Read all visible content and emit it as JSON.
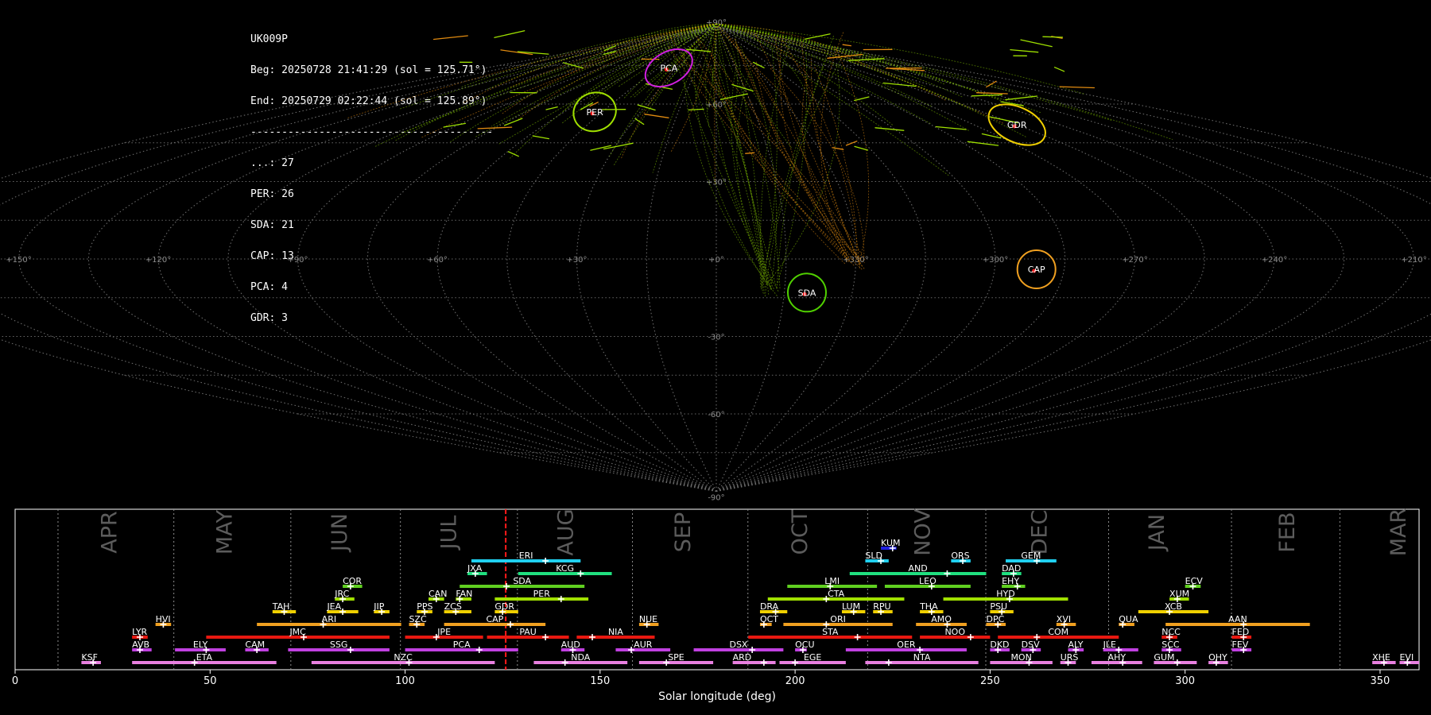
{
  "stats": {
    "lines": [
      "UK009P",
      "Beg: 20250728 21:41:29 (sol = 125.71°)",
      "End: 20250729 02:22:44 (sol = 125.89°)",
      "---------------------------------------",
      "...: 27",
      "PER: 26",
      "SDA: 21",
      "CAP: 13",
      "PCA: 4",
      "GDR: 3"
    ]
  },
  "colors": {
    "background": "#000000",
    "grid": "#8c8c8c",
    "sporadic": "#a0d000",
    "orange": "#e08a10",
    "cursor": "#ff1a1a"
  },
  "chart_data": [
    {
      "type": "scatter",
      "projection": "sinusoidal",
      "ra_ticks": [
        "+180°",
        "+150°",
        "+120°",
        "+90°",
        "+60°",
        "+30°",
        "+0°",
        "+330°",
        "+300°",
        "+270°",
        "+240°",
        "+210°",
        "+180°"
      ],
      "dec_ticks": [
        "+90°",
        "+60°",
        "+30°",
        "-30°",
        "-60°",
        "-90°"
      ],
      "radiants": [
        {
          "code": "PCA",
          "ra": -37,
          "dec": 74,
          "color": "#d020e0"
        },
        {
          "code": "PER",
          "ra": -48,
          "dec": 57,
          "color": "#a0e000"
        },
        {
          "code": "GDR",
          "ra": 105,
          "dec": 52,
          "color": "#f0d000"
        },
        {
          "code": "CAP",
          "ra": 69,
          "dec": -4,
          "color": "#f0a020"
        },
        {
          "code": "SDA",
          "ra": 20,
          "dec": -13,
          "color": "#50d000"
        }
      ],
      "meteor_counts": [
        {
          "label": "...",
          "count": 27
        },
        {
          "label": "PER",
          "count": 26
        },
        {
          "label": "SDA",
          "count": 21
        },
        {
          "label": "CAP",
          "count": 13
        },
        {
          "label": "PCA",
          "count": 4
        },
        {
          "label": "GDR",
          "count": 3
        }
      ]
    },
    {
      "type": "bar",
      "title": "",
      "xlabel": "Solar longitude (deg)",
      "xlim": [
        0,
        360
      ],
      "xticks": [
        0,
        50,
        100,
        150,
        200,
        250,
        300,
        350
      ],
      "current_sol": 125.8,
      "months": [
        {
          "name": "APR",
          "center": 24.5,
          "boundary_end": 40.7
        },
        {
          "name": "MAY",
          "center": 54,
          "boundary_end": 70.7
        },
        {
          "name": "JUN",
          "center": 83.5,
          "boundary_end": 98.8
        },
        {
          "name": "JUL",
          "center": 111.5,
          "boundary_end": 128.8
        },
        {
          "name": "AUG",
          "center": 141.5,
          "boundary_end": 158.3
        },
        {
          "name": "SEP",
          "center": 171.5,
          "boundary_end": 187.9
        },
        {
          "name": "OCT",
          "center": 201.5,
          "boundary_end": 218.6
        },
        {
          "name": "NOV",
          "center": 233,
          "boundary_end": 248.9
        },
        {
          "name": "DEC",
          "center": 263,
          "boundary_end": 280.4
        },
        {
          "name": "JAN",
          "center": 293,
          "boundary_end": 311.9
        },
        {
          "name": "FEB",
          "center": 326.5,
          "boundary_end": 339.7
        },
        {
          "name": "MAR",
          "center": 355,
          "boundary_end": null
        }
      ],
      "first_boundary": 11,
      "showers": [
        {
          "code": "KSF",
          "row": 0,
          "start": 17,
          "end": 22,
          "peak": 20,
          "color": "#e880e0"
        },
        {
          "code": "ETA",
          "row": 0,
          "start": 30,
          "end": 67,
          "peak": 46,
          "color": "#e880e0"
        },
        {
          "code": "NZC",
          "row": 0,
          "start": 76,
          "end": 123,
          "peak": 101,
          "color": "#e880e0"
        },
        {
          "code": "NDA",
          "row": 0,
          "start": 133,
          "end": 157,
          "peak": 141,
          "color": "#e880e0"
        },
        {
          "code": "SPE",
          "row": 0,
          "start": 160,
          "end": 179,
          "peak": 167,
          "color": "#e880e0"
        },
        {
          "code": "ARD",
          "row": 0,
          "start": 184,
          "end": 195,
          "peak": 192,
          "color": "#e880e0"
        },
        {
          "code": "EGE",
          "row": 0,
          "start": 196,
          "end": 213,
          "peak": 200,
          "color": "#e880e0"
        },
        {
          "code": "NTA",
          "row": 0,
          "start": 218,
          "end": 247,
          "peak": 224,
          "color": "#e880e0"
        },
        {
          "code": "MON",
          "row": 0,
          "start": 250,
          "end": 266,
          "peak": 260,
          "color": "#e880e0"
        },
        {
          "code": "URS",
          "row": 0,
          "start": 268,
          "end": 272,
          "peak": 270,
          "color": "#e880e0"
        },
        {
          "code": "AHY",
          "row": 0,
          "start": 276,
          "end": 289,
          "peak": 284,
          "color": "#e880e0"
        },
        {
          "code": "GUM",
          "row": 0,
          "start": 292,
          "end": 303,
          "peak": 298,
          "color": "#e880e0"
        },
        {
          "code": "OHY",
          "row": 0,
          "start": 306,
          "end": 311,
          "peak": 308,
          "color": "#e880e0"
        },
        {
          "code": "XHE",
          "row": 0,
          "start": 348,
          "end": 354,
          "peak": 351,
          "color": "#e880e0"
        },
        {
          "code": "EVI",
          "row": 0,
          "start": 355,
          "end": 360,
          "peak": 357,
          "color": "#e880e0"
        },
        {
          "code": "AVB",
          "row": 1,
          "start": 30,
          "end": 35,
          "peak": 32,
          "color": "#c040e0"
        },
        {
          "code": "ELY",
          "row": 1,
          "start": 41,
          "end": 54,
          "peak": 49,
          "color": "#c040e0"
        },
        {
          "code": "CAM",
          "row": 1,
          "start": 59,
          "end": 65,
          "peak": 62,
          "color": "#c040e0"
        },
        {
          "code": "SSG",
          "row": 1,
          "start": 70,
          "end": 96,
          "peak": 86,
          "color": "#c040e0"
        },
        {
          "code": "PCA",
          "row": 1,
          "start": 100,
          "end": 129,
          "peak": 119,
          "color": "#c040e0"
        },
        {
          "code": "AUD",
          "row": 1,
          "start": 140,
          "end": 146,
          "peak": 143,
          "color": "#c040e0"
        },
        {
          "code": "AUR",
          "row": 1,
          "start": 154,
          "end": 168,
          "peak": 158,
          "color": "#c040e0"
        },
        {
          "code": "DSX",
          "row": 1,
          "start": 174,
          "end": 197,
          "peak": 189,
          "color": "#c040e0"
        },
        {
          "code": "OCU",
          "row": 1,
          "start": 200,
          "end": 203,
          "peak": 202,
          "color": "#c040e0"
        },
        {
          "code": "OER",
          "row": 1,
          "start": 213,
          "end": 244,
          "peak": 232,
          "color": "#c040e0"
        },
        {
          "code": "DKD",
          "row": 1,
          "start": 250,
          "end": 255,
          "peak": 252,
          "color": "#c040e0"
        },
        {
          "code": "DSV",
          "row": 1,
          "start": 258,
          "end": 263,
          "peak": 261,
          "color": "#c040e0"
        },
        {
          "code": "ALY",
          "row": 1,
          "start": 270,
          "end": 274,
          "peak": 272,
          "color": "#c040e0"
        },
        {
          "code": "JLE",
          "row": 1,
          "start": 279,
          "end": 288,
          "peak": 283,
          "color": "#c040e0"
        },
        {
          "code": "SCC",
          "row": 1,
          "start": 294,
          "end": 299,
          "peak": 296,
          "color": "#c040e0"
        },
        {
          "code": "FEV",
          "row": 1,
          "start": 312,
          "end": 317,
          "peak": 315,
          "color": "#c040e0"
        },
        {
          "code": "LYR",
          "row": 2,
          "start": 30,
          "end": 34,
          "peak": 32,
          "color": "#e81810"
        },
        {
          "code": "JMC",
          "row": 2,
          "start": 49,
          "end": 96,
          "peak": 74,
          "color": "#e81810"
        },
        {
          "code": "JPE",
          "row": 2,
          "start": 100,
          "end": 120,
          "peak": 108,
          "color": "#e81810"
        },
        {
          "code": "PAU",
          "row": 2,
          "start": 121,
          "end": 142,
          "peak": 136,
          "color": "#e81810"
        },
        {
          "code": "NIA",
          "row": 2,
          "start": 144,
          "end": 164,
          "peak": 148,
          "color": "#e81810"
        },
        {
          "code": "STA",
          "row": 2,
          "start": 188,
          "end": 230,
          "peak": 216,
          "color": "#e81810"
        },
        {
          "code": "NOO",
          "row": 2,
          "start": 232,
          "end": 250,
          "peak": 245,
          "color": "#e81810"
        },
        {
          "code": "COM",
          "row": 2,
          "start": 252,
          "end": 283,
          "peak": 262,
          "color": "#e81810"
        },
        {
          "code": "NCC",
          "row": 2,
          "start": 294,
          "end": 298,
          "peak": 296,
          "color": "#e81810"
        },
        {
          "code": "FED",
          "row": 2,
          "start": 312,
          "end": 317,
          "peak": 315,
          "color": "#e81810"
        },
        {
          "code": "HVI",
          "row": 3,
          "start": 36,
          "end": 40,
          "peak": 38,
          "color": "#f0a020"
        },
        {
          "code": "ARI",
          "row": 3,
          "start": 62,
          "end": 99,
          "peak": 79,
          "color": "#f0a020"
        },
        {
          "code": "SZC",
          "row": 3,
          "start": 101,
          "end": 105,
          "peak": 103,
          "color": "#f0a020"
        },
        {
          "code": "CAP",
          "row": 3,
          "start": 110,
          "end": 136,
          "peak": 127,
          "color": "#f0a020"
        },
        {
          "code": "NUE",
          "row": 3,
          "start": 160,
          "end": 165,
          "peak": 162,
          "color": "#f0a020"
        },
        {
          "code": "OCT",
          "row": 3,
          "start": 191,
          "end": 194,
          "peak": 192,
          "color": "#f0a020"
        },
        {
          "code": "ORI",
          "row": 3,
          "start": 197,
          "end": 225,
          "peak": 208,
          "color": "#f0a020"
        },
        {
          "code": "AMO",
          "row": 3,
          "start": 231,
          "end": 244,
          "peak": 239,
          "color": "#f0a020"
        },
        {
          "code": "DPC",
          "row": 3,
          "start": 249,
          "end": 254,
          "peak": 252,
          "color": "#f0a020"
        },
        {
          "code": "XVI",
          "row": 3,
          "start": 267,
          "end": 272,
          "peak": 269,
          "color": "#f0a020"
        },
        {
          "code": "QUA",
          "row": 3,
          "start": 283,
          "end": 287,
          "peak": 284,
          "color": "#f0a020"
        },
        {
          "code": "AAN",
          "row": 3,
          "start": 295,
          "end": 332,
          "peak": 315,
          "color": "#f0a020"
        },
        {
          "code": "TAH",
          "row": 4,
          "start": 66,
          "end": 72,
          "peak": 69,
          "color": "#f0d000"
        },
        {
          "code": "JEA",
          "row": 4,
          "start": 80,
          "end": 88,
          "peak": 84,
          "color": "#f0d000"
        },
        {
          "code": "JIP",
          "row": 4,
          "start": 92,
          "end": 96,
          "peak": 94,
          "color": "#f0d000"
        },
        {
          "code": "PPS",
          "row": 4,
          "start": 103,
          "end": 107,
          "peak": 105,
          "color": "#f0d000"
        },
        {
          "code": "ZCS",
          "row": 4,
          "start": 110,
          "end": 117,
          "peak": 113,
          "color": "#f0d000"
        },
        {
          "code": "GDR",
          "row": 4,
          "start": 123,
          "end": 129,
          "peak": 125,
          "color": "#f0d000"
        },
        {
          "code": "DRA",
          "row": 4,
          "start": 191,
          "end": 198,
          "peak": 195,
          "color": "#f0d000"
        },
        {
          "code": "LUM",
          "row": 4,
          "start": 212,
          "end": 218,
          "peak": 215,
          "color": "#f0d000"
        },
        {
          "code": "RPU",
          "row": 4,
          "start": 220,
          "end": 225,
          "peak": 222,
          "color": "#f0d000"
        },
        {
          "code": "THA",
          "row": 4,
          "start": 232,
          "end": 238,
          "peak": 235,
          "color": "#f0d000"
        },
        {
          "code": "PSU",
          "row": 4,
          "start": 250,
          "end": 256,
          "peak": 253,
          "color": "#f0d000"
        },
        {
          "code": "XCB",
          "row": 4,
          "start": 288,
          "end": 306,
          "peak": 296,
          "color": "#f0d000"
        },
        {
          "code": "JRC",
          "row": 5,
          "start": 82,
          "end": 87,
          "peak": 84,
          "color": "#a0e000"
        },
        {
          "code": "CAN",
          "row": 5,
          "start": 106,
          "end": 110,
          "peak": 108,
          "color": "#a0e000"
        },
        {
          "code": "FAN",
          "row": 5,
          "start": 113,
          "end": 117,
          "peak": 114,
          "color": "#a0e000"
        },
        {
          "code": "PER",
          "row": 5,
          "start": 123,
          "end": 147,
          "peak": 140,
          "color": "#a0e000"
        },
        {
          "code": "CTA",
          "row": 5,
          "start": 193,
          "end": 228,
          "peak": 208,
          "color": "#a0e000"
        },
        {
          "code": "HYD",
          "row": 5,
          "start": 238,
          "end": 270,
          "peak": 255,
          "color": "#a0e000"
        },
        {
          "code": "XUM",
          "row": 5,
          "start": 296,
          "end": 301,
          "peak": 298,
          "color": "#a0e000"
        },
        {
          "code": "COR",
          "row": 6,
          "start": 84,
          "end": 89,
          "peak": 86,
          "color": "#60d020"
        },
        {
          "code": "SDA",
          "row": 6,
          "start": 114,
          "end": 146,
          "peak": 126,
          "color": "#60d020"
        },
        {
          "code": "LMI",
          "row": 6,
          "start": 198,
          "end": 221,
          "peak": 209,
          "color": "#60d020"
        },
        {
          "code": "LEO",
          "row": 6,
          "start": 223,
          "end": 245,
          "peak": 235,
          "color": "#60d020"
        },
        {
          "code": "EHY",
          "row": 6,
          "start": 253,
          "end": 259,
          "peak": 257,
          "color": "#60d020"
        },
        {
          "code": "ECV",
          "row": 6,
          "start": 300,
          "end": 304,
          "peak": 302,
          "color": "#60d020"
        },
        {
          "code": "JXA",
          "row": 7,
          "start": 116,
          "end": 121,
          "peak": 118,
          "color": "#20e080"
        },
        {
          "code": "KCG",
          "row": 7,
          "start": 129,
          "end": 153,
          "peak": 145,
          "color": "#20e080"
        },
        {
          "code": "AND",
          "row": 7,
          "start": 214,
          "end": 249,
          "peak": 239,
          "color": "#20e080"
        },
        {
          "code": "DAD",
          "row": 7,
          "start": 253,
          "end": 258,
          "peak": 256,
          "color": "#20e080"
        },
        {
          "code": "ERI",
          "row": 8,
          "start": 117,
          "end": 145,
          "peak": 136,
          "color": "#20d0f0"
        },
        {
          "code": "SLD",
          "row": 8,
          "start": 218,
          "end": 224,
          "peak": 222,
          "color": "#20d0f0"
        },
        {
          "code": "ORS",
          "row": 8,
          "start": 240,
          "end": 245,
          "peak": 243,
          "color": "#20d0f0"
        },
        {
          "code": "GEM",
          "row": 8,
          "start": 254,
          "end": 267,
          "peak": 262,
          "color": "#20d0f0"
        },
        {
          "code": "KUM",
          "row": 9,
          "start": 222,
          "end": 226,
          "peak": 225,
          "color": "#2020e0"
        }
      ]
    }
  ]
}
